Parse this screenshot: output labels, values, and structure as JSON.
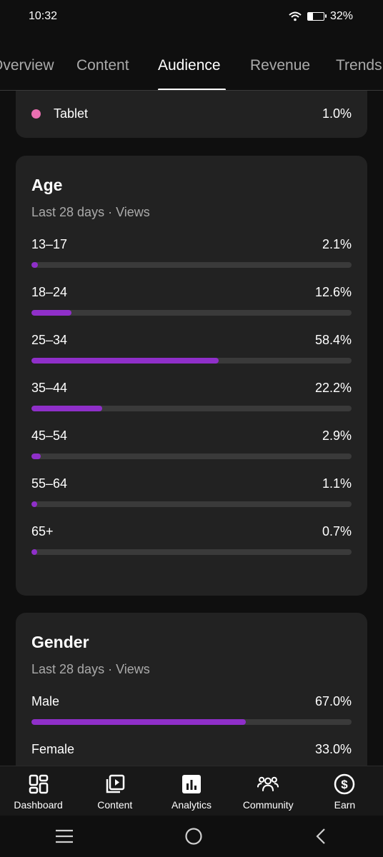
{
  "status": {
    "time": "10:32",
    "battery": "32%"
  },
  "tabs": [
    {
      "label": "Overview"
    },
    {
      "label": "Content"
    },
    {
      "label": "Audience"
    },
    {
      "label": "Revenue"
    },
    {
      "label": "Trends"
    }
  ],
  "device_tail": {
    "label": "Tablet",
    "value": "1.0%",
    "dot_color": "#e96fb1"
  },
  "age": {
    "title": "Age",
    "subtitle": "Last 28 days · Views",
    "rows": [
      {
        "label": "13–17",
        "value": "2.1%",
        "pct": 2.1
      },
      {
        "label": "18–24",
        "value": "12.6%",
        "pct": 12.6
      },
      {
        "label": "25–34",
        "value": "58.4%",
        "pct": 58.4
      },
      {
        "label": "35–44",
        "value": "22.2%",
        "pct": 22.2
      },
      {
        "label": "45–54",
        "value": "2.9%",
        "pct": 2.9
      },
      {
        "label": "55–64",
        "value": "1.1%",
        "pct": 1.1
      },
      {
        "label": "65+",
        "value": "0.7%",
        "pct": 0.7
      }
    ]
  },
  "gender": {
    "title": "Gender",
    "subtitle": "Last 28 days · Views",
    "rows": [
      {
        "label": "Male",
        "value": "67.0%",
        "pct": 67.0
      },
      {
        "label": "Female",
        "value": "33.0%",
        "pct": 33.0
      }
    ]
  },
  "bottom_nav": [
    {
      "label": "Dashboard",
      "icon": "dashboard-icon"
    },
    {
      "label": "Content",
      "icon": "content-icon"
    },
    {
      "label": "Analytics",
      "icon": "analytics-icon"
    },
    {
      "label": "Community",
      "icon": "community-icon"
    },
    {
      "label": "Earn",
      "icon": "earn-icon"
    }
  ],
  "colors": {
    "accent": "#8f2fc9",
    "track": "#3a3a3a",
    "card": "#222222",
    "background": "#0f0f0f"
  }
}
